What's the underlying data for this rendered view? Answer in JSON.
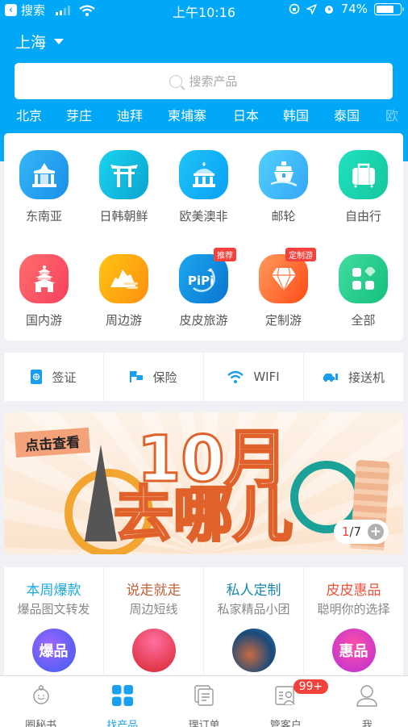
{
  "status_bar": {
    "back_app": "搜索",
    "time": "上午10:16",
    "battery": "74%",
    "battery_level": 0.74
  },
  "header": {
    "city": "上海",
    "search_placeholder": "搜索产品",
    "destinations": [
      "北京",
      "芽庄",
      "迪拜",
      "柬埔寨",
      "日本",
      "韩国",
      "泰国",
      "欧"
    ]
  },
  "categories": [
    {
      "label": "东南亚",
      "icon": "temple-icon",
      "color_from": "#35b6f7",
      "color_to": "#1a8fe9"
    },
    {
      "label": "日韩朝鲜",
      "icon": "torii-gate-icon",
      "color_from": "#1ad4f0",
      "color_to": "#0aa3d0"
    },
    {
      "label": "欧美澳非",
      "icon": "dome-building-icon",
      "color_from": "#1ec3f7",
      "color_to": "#0aa0f5"
    },
    {
      "label": "邮轮",
      "icon": "cruise-ship-icon",
      "color_from": "#4fd0fb",
      "color_to": "#35a6f7"
    },
    {
      "label": "自由行",
      "icon": "luggage-icon",
      "color_from": "#1fe2c0",
      "color_to": "#15c79d"
    },
    {
      "label": "国内游",
      "icon": "pagoda-icon",
      "color_from": "#ff6d6d",
      "color_to": "#f6415d"
    },
    {
      "label": "周边游",
      "icon": "mountain-icon",
      "color_from": "#ffc412",
      "color_to": "#ff9010"
    },
    {
      "label": "皮皮旅游",
      "icon": "pipi-logo-icon",
      "color_from": "#1ba8ee",
      "color_to": "#0a74d0",
      "badge": "推荐"
    },
    {
      "label": "定制游",
      "icon": "diamond-icon",
      "color_from": "#ff9a5c",
      "color_to": "#ff4b16",
      "badge": "定制游"
    },
    {
      "label": "全部",
      "icon": "grid-icon",
      "color_from": "#41dca0",
      "color_to": "#14bf7e"
    }
  ],
  "services": [
    {
      "label": "签证",
      "icon": "passport-icon"
    },
    {
      "label": "保险",
      "icon": "flag-icon"
    },
    {
      "label": "WIFI",
      "icon": "wifi-icon"
    },
    {
      "label": "接送机",
      "icon": "car-icon"
    }
  ],
  "banner": {
    "tag": "点击查看",
    "title_line1": "10月",
    "title_line2": "去哪儿",
    "page_current": "1",
    "page_total": "/7"
  },
  "promos": [
    {
      "title": "本周爆款",
      "subtitle": "爆品图文转发",
      "color": "#1aa8e8",
      "img_text": "爆品"
    },
    {
      "title": "说走就走",
      "subtitle": "周边短线",
      "color": "#c7603a",
      "img_text": ""
    },
    {
      "title": "私人定制",
      "subtitle": "私家精品小团",
      "color": "#1a86b0",
      "img_text": ""
    },
    {
      "title": "皮皮惠品",
      "subtitle": "聪明你的选择",
      "color": "#f0523c",
      "img_text": "惠品"
    }
  ],
  "tabbar": {
    "items": [
      {
        "label": "圈秘书",
        "icon": "assistant-icon"
      },
      {
        "label": "找产品",
        "icon": "grid-icon",
        "active": true
      },
      {
        "label": "理订单",
        "icon": "orders-icon"
      },
      {
        "label": "管客户",
        "icon": "customers-icon",
        "badge": "99+"
      },
      {
        "label": "我",
        "icon": "profile-icon"
      }
    ]
  },
  "colors": {
    "brand": "#00a8f7",
    "accent_red": "#f5413c",
    "active_tab": "#1aa0f0"
  }
}
